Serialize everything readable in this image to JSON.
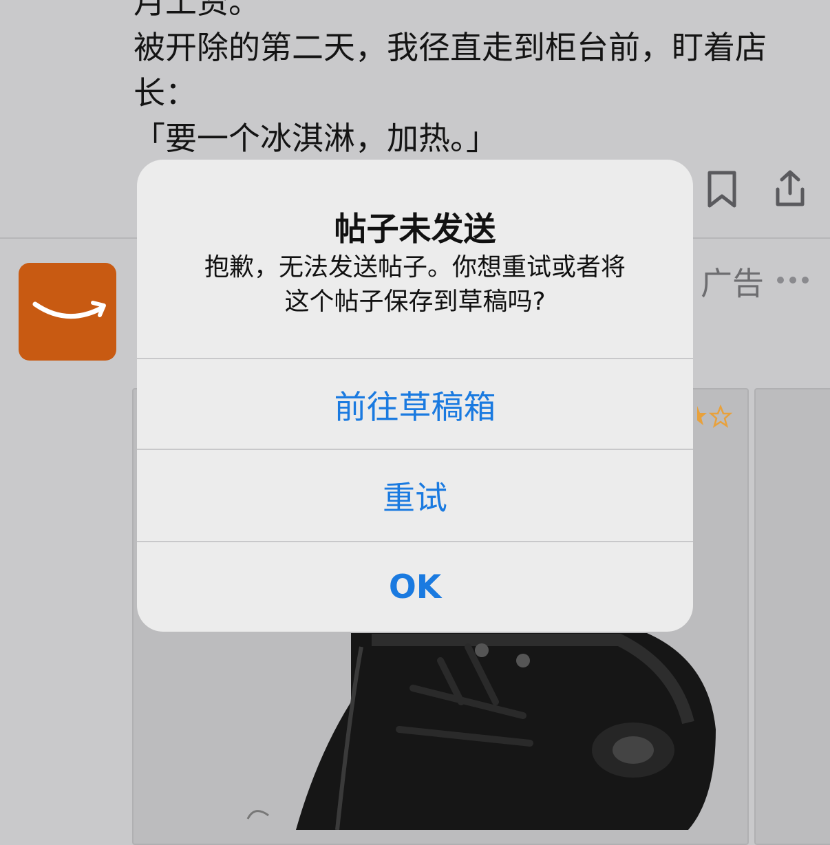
{
  "post": {
    "lines": [
      "月工资。",
      "被开除的第二天，我径直走到柜台前，盯着店",
      "长：",
      "「要一个冰淇淋，加热。」"
    ]
  },
  "ad": {
    "label": "广告",
    "avatar_icon": "amazon-smile-logo",
    "rating_icon": "stars-icon"
  },
  "alert": {
    "title": "帖子未发送",
    "message_line1": "抱歉，无法发送帖子。你想重试或者将",
    "message_line2": "这个帖子保存到草稿吗?",
    "buttons": {
      "drafts": "前往草稿箱",
      "retry": "重试",
      "ok": "OK"
    }
  },
  "colors": {
    "accent": "#1a7ae0",
    "brand": "#c85a12",
    "dim_background": "#c9c9cb"
  }
}
